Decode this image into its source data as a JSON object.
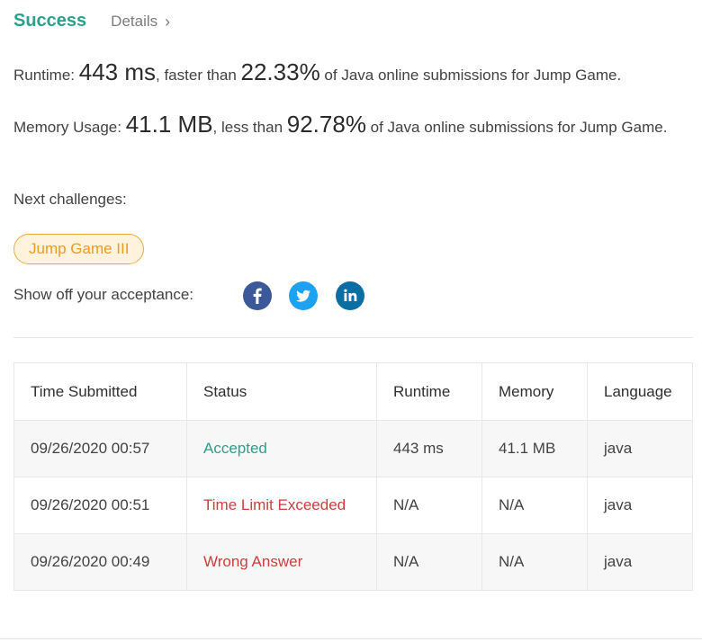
{
  "header": {
    "success_label": "Success",
    "details_label": "Details",
    "chevron": "›"
  },
  "runtime": {
    "label": "Runtime: ",
    "value": "443 ms",
    "middle": ", faster than ",
    "percent": "22.33%",
    "suffix": " of Java online submissions for Jump Game."
  },
  "memory": {
    "label": "Memory Usage: ",
    "value": "41.1 MB",
    "middle": ", less than ",
    "percent": "92.78%",
    "suffix": " of Java online submissions for Jump Game."
  },
  "next": {
    "label": "Next challenges:",
    "challenges": [
      "Jump Game III"
    ]
  },
  "share": {
    "label": "Show off your acceptance:",
    "icons": [
      "facebook-icon",
      "twitter-icon",
      "linkedin-icon"
    ]
  },
  "table": {
    "headers": [
      "Time Submitted",
      "Status",
      "Runtime",
      "Memory",
      "Language"
    ],
    "rows": [
      {
        "time": "09/26/2020 00:57",
        "status": "Accepted",
        "runtime": "443 ms",
        "memory": "41.1 MB",
        "language": "java"
      },
      {
        "time": "09/26/2020 00:51",
        "status": "Time Limit Exceeded",
        "runtime": "N/A",
        "memory": "N/A",
        "language": "java"
      },
      {
        "time": "09/26/2020 00:49",
        "status": "Wrong Answer",
        "runtime": "N/A",
        "memory": "N/A",
        "language": "java"
      }
    ]
  },
  "colors": {
    "success": "#2c9f8d",
    "error": "#d13c3c",
    "chip_border": "#f4a83c",
    "chip_bg": "#fff3dd",
    "facebook": "#3b5999",
    "twitter": "#1da1f2",
    "linkedin": "#0a6ea3"
  }
}
